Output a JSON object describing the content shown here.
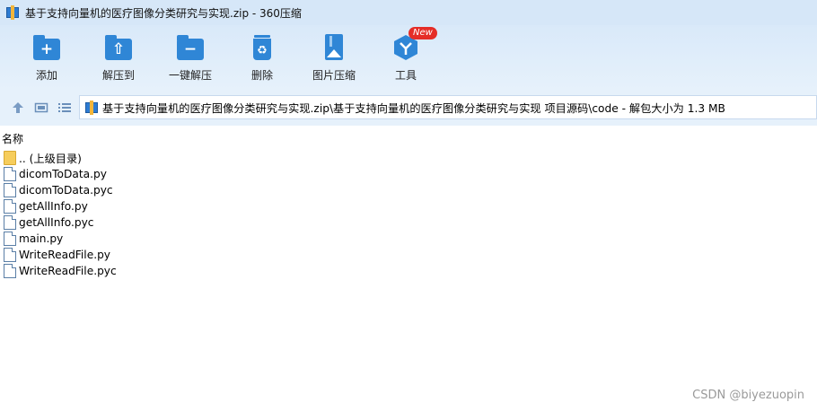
{
  "window": {
    "title": "基于支持向量机的医疗图像分类研究与实现.zip - 360压缩"
  },
  "toolbar": {
    "items": [
      {
        "label": "添加",
        "icon": "add-folder-icon"
      },
      {
        "label": "解压到",
        "icon": "extract-to-icon"
      },
      {
        "label": "一键解压",
        "icon": "one-click-extract-icon"
      },
      {
        "label": "删除",
        "icon": "recycle-delete-icon"
      },
      {
        "label": "图片压缩",
        "icon": "image-compress-icon"
      },
      {
        "label": "工具",
        "icon": "tools-icon",
        "badge": "New"
      }
    ]
  },
  "nav": {
    "path": "基于支持向量机的医疗图像分类研究与实现.zip\\基于支持向量机的医疗图像分类研究与实现 项目源码\\code - 解包大小为 1.3 MB"
  },
  "list": {
    "column_name": "名称",
    "items": [
      {
        "name": ".. (上级目录)",
        "type": "folder"
      },
      {
        "name": "dicomToData.py",
        "type": "file"
      },
      {
        "name": "dicomToData.pyc",
        "type": "file"
      },
      {
        "name": "getAllInfo.py",
        "type": "file"
      },
      {
        "name": "getAllInfo.pyc",
        "type": "file"
      },
      {
        "name": "main.py",
        "type": "file"
      },
      {
        "name": "WriteReadFile.py",
        "type": "file"
      },
      {
        "name": "WriteReadFile.pyc",
        "type": "file"
      }
    ]
  },
  "watermark": "CSDN @biyezuopin",
  "colors": {
    "accent": "#2f86d6",
    "toolbar_bg": "#d9e9f9",
    "badge": "#e52d27"
  }
}
